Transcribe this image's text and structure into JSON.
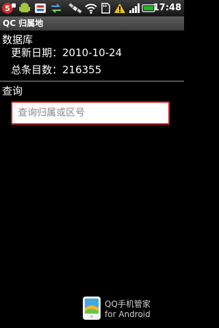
{
  "status_bar": {
    "time": "17:48",
    "icons": [
      "notification-badge-icon",
      "android-icon",
      "dock-icon",
      "transfer-icon",
      "satellite-icon",
      "wifi-icon",
      "sd-card-icon",
      "warning-icon",
      "battery-icon"
    ],
    "colors": {
      "battery": "#1fb81f",
      "warning": "#e8c21a",
      "accent": "#d41f1f"
    }
  },
  "title_bar": {
    "title": "QC 归属地"
  },
  "database": {
    "heading": "数据库",
    "update_date": "更新日期：2010-10-24",
    "total_count": "总条目数：216355"
  },
  "query": {
    "heading": "查询",
    "input_placeholder": "查询归属或区号",
    "input_value": ""
  },
  "footer": {
    "brand_line1": "QQ手机管家",
    "brand_line2": "for Android"
  }
}
